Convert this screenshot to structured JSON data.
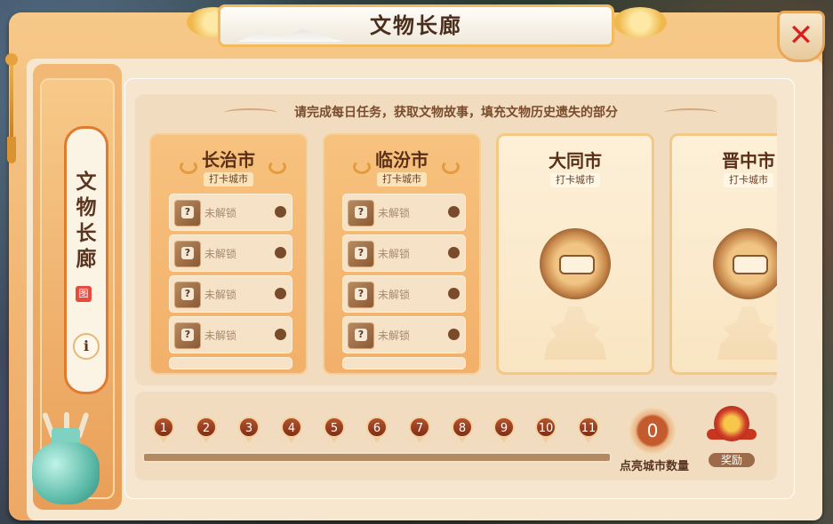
{
  "title": "文物长廊",
  "sidebar": {
    "vertical_title": [
      "文",
      "物",
      "长",
      "廊"
    ],
    "seal": "图",
    "info": "i"
  },
  "hint": "请完成每日任务，获取文物故事，填充文物历史遗失的部分",
  "cards": [
    {
      "city": "长治市",
      "tag": "打卡城市",
      "state": "unlocked",
      "items": [
        "未解锁",
        "未解锁",
        "未解锁",
        "未解锁"
      ]
    },
    {
      "city": "临汾市",
      "tag": "打卡城市",
      "state": "unlocked",
      "items": [
        "未解锁",
        "未解锁",
        "未解锁",
        "未解锁"
      ]
    },
    {
      "city": "大同市",
      "tag": "打卡城市",
      "state": "locked"
    },
    {
      "city": "晋中市",
      "tag": "打卡城市",
      "state": "locked"
    }
  ],
  "progress": {
    "nodes": [
      "1",
      "2",
      "3",
      "4",
      "5",
      "6",
      "7",
      "8",
      "9",
      "10",
      "11"
    ],
    "count": "0",
    "count_label": "点亮城市数量",
    "reward_label": "奖励"
  },
  "icons": {
    "close": "close-icon",
    "info": "info-icon",
    "lock": "lock-icon",
    "reward": "reward-chest-icon"
  },
  "colors": {
    "frame": "#eea866",
    "close_x": "#d8201e",
    "pin": "#7e2f15"
  }
}
